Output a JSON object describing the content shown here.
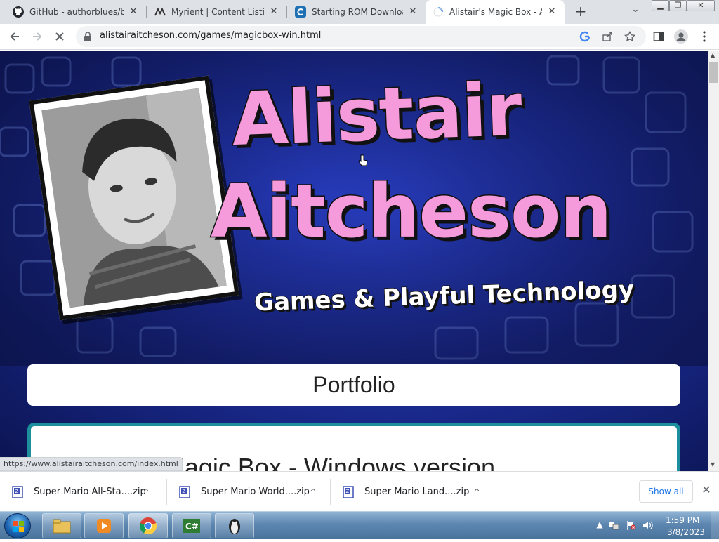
{
  "browser": {
    "tabs": [
      {
        "title": "GitHub - authorblues/biz",
        "favicon": "github-icon"
      },
      {
        "title": "Myrient | Content Listing",
        "favicon": "myrient-icon"
      },
      {
        "title": "Starting ROM Download",
        "favicon": "rom-download-icon"
      },
      {
        "title": "Alistair's Magic Box - Alis",
        "favicon": "loading-icon",
        "active": true
      }
    ],
    "tab_close_glyph": "✕",
    "new_tab_glyph": "+",
    "tab_menu_glyph": "⌄",
    "window_controls": [
      "▁",
      "❐",
      "✕"
    ],
    "url": "alistairaitcheson.com/games/magicbox-win.html",
    "status_url": "https://www.alistairaitcheson.com/index.html"
  },
  "page": {
    "logo_line1": "Alistair",
    "logo_line2": "Aitcheson",
    "tagline": "Games & Playful Technology",
    "portfolio_heading": "Portfolio",
    "card_title": "Alistair's Magic Box - Windows version",
    "colors": {
      "accent_pink": "#f59bdc",
      "card_border": "#1d8f9c",
      "background_blue": "#1e2f9e"
    }
  },
  "downloads": {
    "items": [
      {
        "name": "Super Mario All-Sta....zip",
        "icon": "zip-archive-icon"
      },
      {
        "name": "Super Mario World....zip",
        "icon": "zip-archive-icon"
      },
      {
        "name": "Super Mario Land....zip",
        "icon": "zip-archive-icon"
      }
    ],
    "show_all_label": "Show all",
    "close_glyph": "✕",
    "chevron_glyph": "^"
  },
  "taskbar": {
    "time": "1:59 PM",
    "date": "3/8/2023",
    "apps": [
      "file-explorer-icon",
      "media-player-icon",
      "chrome-icon",
      "csharp-ide-icon",
      "penguin-app-icon"
    ]
  }
}
